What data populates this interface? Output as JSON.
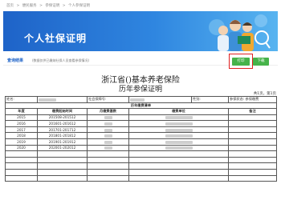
{
  "breadcrumb": [
    "首页",
    ">",
    "便民服务",
    ">",
    "参保证明",
    ">",
    "个人参保证明"
  ],
  "banner": {
    "title": "个人社保证明"
  },
  "result": {
    "label": "查询结果",
    "note": "(数据仅供已缴纳社保人员查看参保情况)",
    "print_button": "打印",
    "download_button": "下载"
  },
  "certificate": {
    "title": "浙江省()基本养老保险",
    "subtitle": "历年参保证明",
    "page_info": "共1页，第1页",
    "info_row": {
      "name_label": "姓名:",
      "ss_label": "社会保障号:",
      "gender_label": "性别:",
      "status_label": "参保状态:",
      "status_value": "参保缴费"
    },
    "section_title": "历年缴费清单",
    "columns": [
      "年度",
      "缴费起始时间",
      "月缴费基数",
      "缴费单位",
      "备注"
    ],
    "rows": [
      {
        "year": "2015",
        "period": "201508-201512"
      },
      {
        "year": "2016",
        "period": "201601-201612"
      },
      {
        "year": "2017",
        "period": "201701-201712"
      },
      {
        "year": "2018",
        "period": "201801-201812"
      },
      {
        "year": "2019",
        "period": "201901-201912"
      },
      {
        "year": "2020",
        "period": "202001-202012"
      }
    ]
  },
  "colors": {
    "banner": "#2f86e0",
    "button": "#46b34a",
    "highlight": "#e02020",
    "link": "#1e63c8"
  }
}
